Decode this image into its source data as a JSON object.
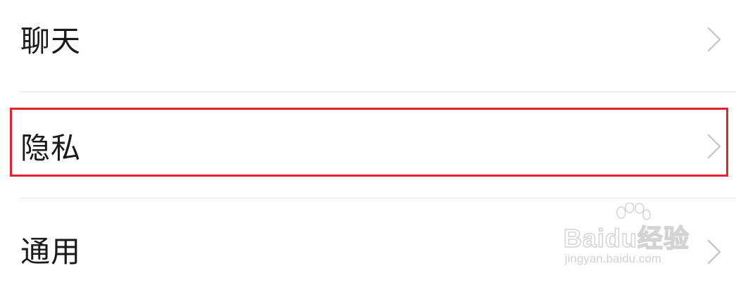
{
  "settings": {
    "items": [
      {
        "label": "聊天",
        "chevron_icon": "chevron-right-icon"
      },
      {
        "label": "隐私",
        "chevron_icon": "chevron-right-icon"
      },
      {
        "label": "通用",
        "chevron_icon": "chevron-right-icon"
      }
    ]
  },
  "highlight": {
    "color": "#e3222e"
  },
  "watermark": {
    "logo_text": "Baidu经验",
    "url": "jingyan.baidu.com"
  }
}
